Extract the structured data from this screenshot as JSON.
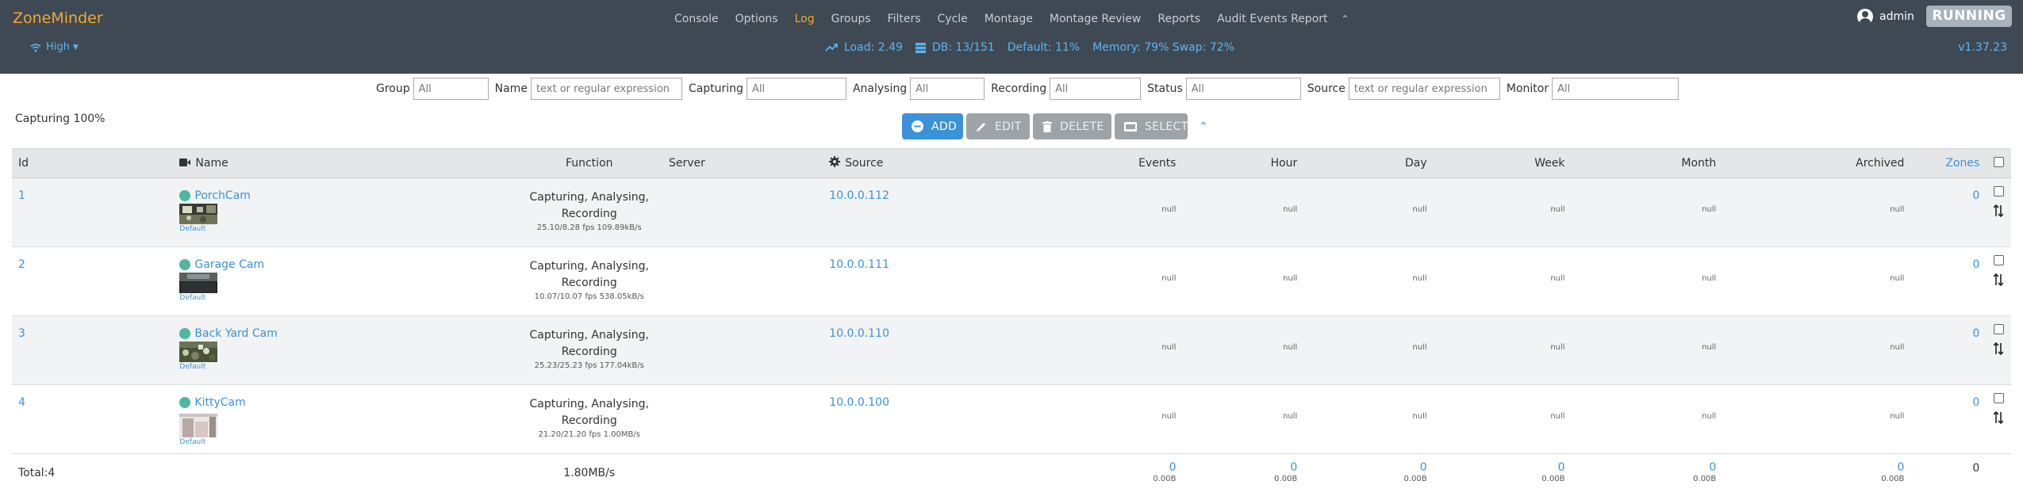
{
  "app": {
    "brand": "ZoneMinder",
    "status": "RUNNING",
    "user": "admin",
    "version": "v1.37.23"
  },
  "nav": [
    "Console",
    "Options",
    "Log",
    "Groups",
    "Filters",
    "Cycle",
    "Montage",
    "Montage Review",
    "Reports",
    "Audit Events Report"
  ],
  "nav_active": "Log",
  "bandwidth": "High",
  "system": {
    "load": "Load: 2.49",
    "db": "DB: 13/151",
    "default": "Default: 11%",
    "memory": "Memory: 79% Swap: 72%"
  },
  "filters": {
    "group_label": "Group",
    "group_ph": "All",
    "name_label": "Name",
    "name_ph": "text or regular expression",
    "capturing_label": "Capturing",
    "capturing_ph": "All",
    "analysing_label": "Analysing",
    "analysing_ph": "All",
    "recording_label": "Recording",
    "recording_ph": "All",
    "status_label": "Status",
    "status_ph": "All",
    "source_label": "Source",
    "source_ph": "text or regular expression",
    "monitor_label": "Monitor",
    "monitor_ph": "All"
  },
  "capturing_status": "Capturing 100%",
  "actions": {
    "add": "ADD",
    "edit": "EDIT",
    "delete": "DELETE",
    "select": "SELECT"
  },
  "table": {
    "headers": {
      "id": "Id",
      "name": "Name",
      "function": "Function",
      "server": "Server",
      "source": "Source",
      "events": "Events",
      "hour": "Hour",
      "day": "Day",
      "week": "Week",
      "month": "Month",
      "archived": "Archived",
      "zones": "Zones"
    },
    "rows": [
      {
        "id": "1",
        "name": "PorchCam",
        "default": "Default",
        "function": "Capturing, Analysing, Recording",
        "fps": "25.10/8.28 fps 109.89kB/s",
        "source": "10.0.0.112",
        "events": "null",
        "hour": "null",
        "day": "null",
        "week": "null",
        "month": "null",
        "archived": "null",
        "zones": "0"
      },
      {
        "id": "2",
        "name": "Garage Cam",
        "default": "Default",
        "function": "Capturing, Analysing, Recording",
        "fps": "10.07/10.07 fps 538.05kB/s",
        "source": "10.0.0.111",
        "events": "null",
        "hour": "null",
        "day": "null",
        "week": "null",
        "month": "null",
        "archived": "null",
        "zones": "0"
      },
      {
        "id": "3",
        "name": "Back Yard Cam",
        "default": "Default",
        "function": "Capturing, Analysing, Recording",
        "fps": "25.23/25.23 fps 177.04kB/s",
        "source": "10.0.0.110",
        "events": "null",
        "hour": "null",
        "day": "null",
        "week": "null",
        "month": "null",
        "archived": "null",
        "zones": "0"
      },
      {
        "id": "4",
        "name": "KittyCam",
        "default": "Default",
        "function": "Capturing, Analysing, Recording",
        "fps": "21.20/21.20 fps 1.00MB/s",
        "source": "10.0.0.100",
        "events": "null",
        "hour": "null",
        "day": "null",
        "week": "null",
        "month": "null",
        "archived": "null",
        "zones": "0"
      }
    ],
    "totals": {
      "label": "Total:4",
      "bandwidth": "1.80MB/s",
      "events": "0",
      "events_size": "0.00B",
      "hour": "0",
      "hour_size": "0.00B",
      "day": "0",
      "day_size": "0.00B",
      "week": "0",
      "week_size": "0.00B",
      "month": "0",
      "month_size": "0.00B",
      "archived": "0",
      "archived_size": "0.00B",
      "zones": "0"
    }
  },
  "colors": {
    "navbar": "#3f4954",
    "brand": "#f0a830",
    "link": "#3b92d8",
    "status_dot": "#4fb69f",
    "running_badge": "#a8b2bd"
  }
}
